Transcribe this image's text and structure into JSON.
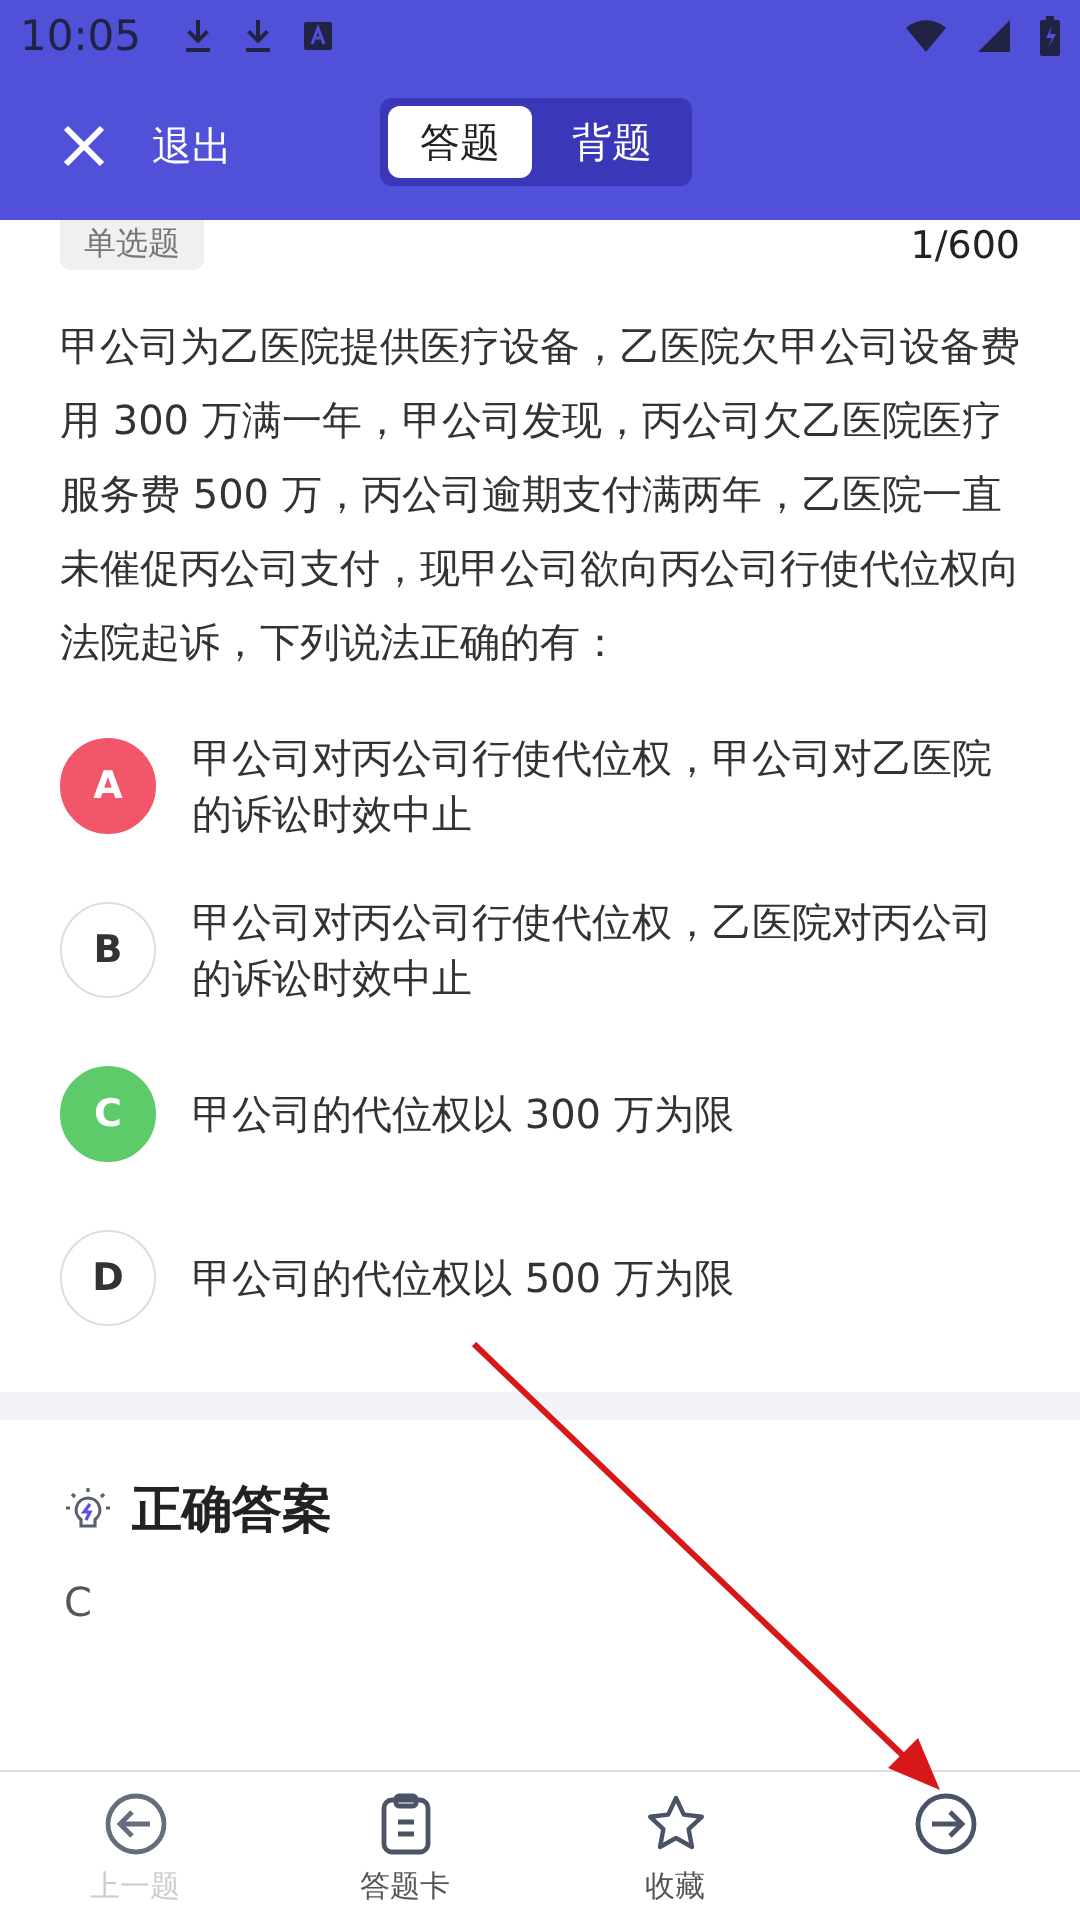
{
  "status_bar": {
    "time": "10:05"
  },
  "header": {
    "close_label": "退出",
    "tabs": [
      {
        "label": "答题",
        "selected": true
      },
      {
        "label": "背题",
        "selected": false
      }
    ]
  },
  "question": {
    "type_tag": "单选题",
    "progress": "1/600",
    "text": "甲公司为乙医院提供医疗设备，乙医院欠甲公司设备费用 300 万满一年，甲公司发现，丙公司欠乙医院医疗服务费 500 万，丙公司逾期支付满两年，乙医院一直未催促丙公司支付，现甲公司欲向丙公司行使代位权向法院起诉，下列说法正确的有：",
    "options": [
      {
        "letter": "A",
        "text": "甲公司对丙公司行使代位权，甲公司对乙医院的诉讼时效中止",
        "selected": true,
        "correct": false
      },
      {
        "letter": "B",
        "text": "甲公司对丙公司行使代位权，乙医院对丙公司的诉讼时效中止",
        "selected": false,
        "correct": false
      },
      {
        "letter": "C",
        "text": "甲公司的代位权以 300 万为限",
        "selected": false,
        "correct": true
      },
      {
        "letter": "D",
        "text": "甲公司的代位权以 500 万为限",
        "selected": false,
        "correct": false
      }
    ]
  },
  "answer": {
    "title": "正确答案",
    "value": "C"
  },
  "bottom_nav": [
    {
      "kind": "prev",
      "label": "上一题",
      "disabled": true
    },
    {
      "kind": "card",
      "label": "答题卡",
      "disabled": false
    },
    {
      "kind": "star",
      "label": "收藏",
      "disabled": false
    },
    {
      "kind": "next"
    }
  ]
}
